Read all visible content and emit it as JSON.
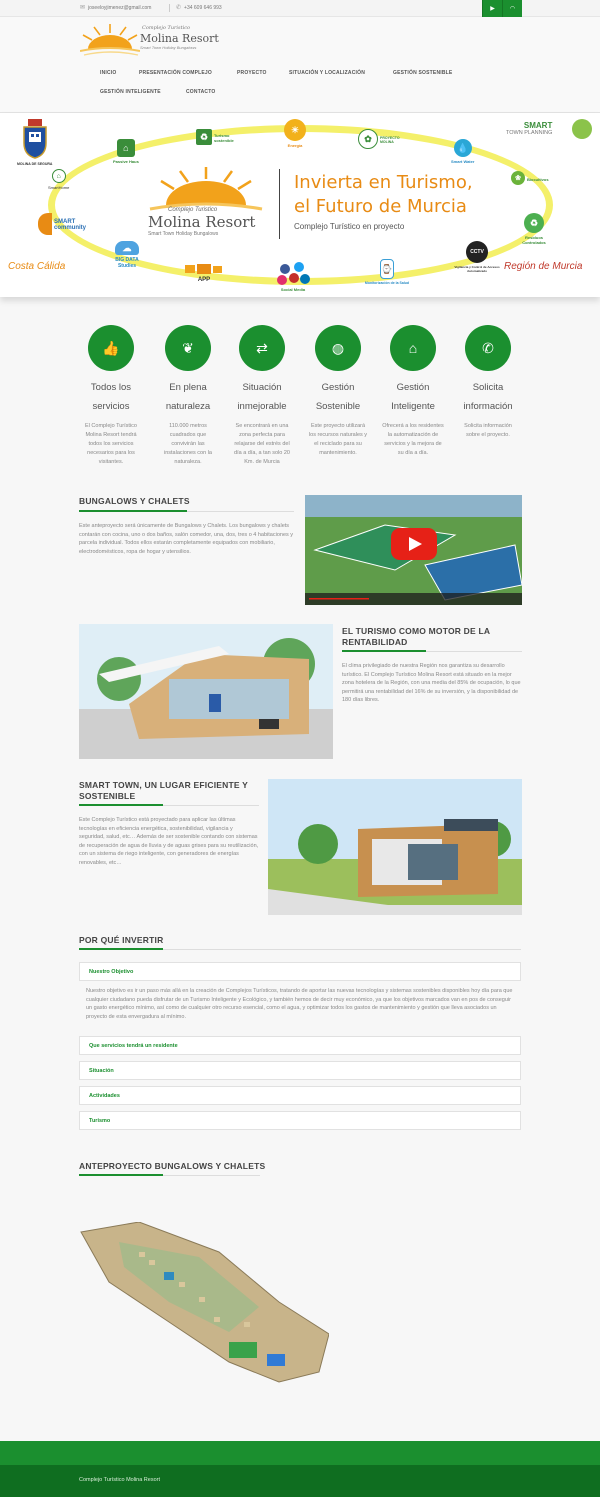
{
  "topbar": {
    "email": "joseeloyjimenez@gmail.com",
    "phone": "+34 609 646 993",
    "social": [
      {
        "icon": "youtube-icon",
        "glyph": "▶"
      },
      {
        "icon": "rss-icon",
        "glyph": "◠"
      }
    ]
  },
  "logo": {
    "small": "Complejo Turistico",
    "name": "Molina Resort",
    "tag": "Smart Town Holiday Bungalows"
  },
  "nav": {
    "inicio": "INICIO",
    "presentacion": "PRESENTACIÓN COMPLEJO",
    "proyecto": "PROYECTO",
    "situacion": "SITUACIÓN Y LOCALIZACIÓN",
    "sostenible": "GESTIÓN SOSTENIBLE",
    "inteligente": "GESTIÓN INTELIGENTE",
    "contacto": "CONTACTO"
  },
  "banner": {
    "title_line1": "Invierta en Turismo,",
    "title_line2": "el Futuro de Murcia",
    "subtitle": "Complejo Turístico en proyecto",
    "logo_small": "Complejo Turistico",
    "logo_name": "Molina Resort",
    "logo_tag": "Smart Town Holiday Bungalows",
    "costa": "Costa Cálida",
    "region": "Región de Murcia",
    "smart_town": "SMART",
    "smart_town2": "TOWN PLANNING",
    "molina_label": "MOLINA DE SEGURA",
    "icons": {
      "passive": "Passive Haus",
      "turismo": "Turismo sostenible",
      "energia": "Energía",
      "proyecto": "PROYECTO MOLINA",
      "water": "Smart Water",
      "biocultivos": "Biocultivos",
      "residuos": "Residuos Controlados",
      "cctv": "CCTV",
      "vigilancia": "Vigilancia y Control de Accesos Automatizado",
      "monitorizacion": "Monitorización de la Salud",
      "social": "Social Media",
      "app": "APP",
      "bigdata": "BIG DATA Studies",
      "smartcommunity": "SMART community",
      "smarthome": "SmartHome"
    }
  },
  "features": [
    {
      "icon": "thumbs-up-icon",
      "glyph": "👍",
      "title1": "Todos los",
      "title2": "servicios",
      "text": "El Complejo Turístico Molina Resort tendrá todos los servicios necesarios para los visitantes."
    },
    {
      "icon": "leaf-icon",
      "glyph": "❦",
      "title1": "En plena",
      "title2": "naturaleza",
      "text": "110.000 metros cuadrados que convivirán las instalaciones con la naturaleza."
    },
    {
      "icon": "signpost-icon",
      "glyph": "⇄",
      "title1": "Situación",
      "title2": "inmejorable",
      "text": "Se encontrará en una zona perfecta para relajarse del estrés del día a día, a tan solo 20 Km. de Murcia"
    },
    {
      "icon": "globe-icon",
      "glyph": "◍",
      "title1": "Gestión",
      "title2": "Sostenible",
      "text": "Este proyecto utilizará los recursos naturales y el reciclado para su mantenimiento."
    },
    {
      "icon": "home-icon",
      "glyph": "⌂",
      "title1": "Gestión",
      "title2": "Inteligente",
      "text": "Ofrecerá a los residentes la automatización de servicios y la mejora de su día a día."
    },
    {
      "icon": "phone-icon",
      "glyph": "✆",
      "title1": "Solicita",
      "title2": "información",
      "text": "Solicita información sobre el proyecto."
    }
  ],
  "bungalows": {
    "title": "BUNGALOWS Y CHALETS",
    "text": "Este anteproyecto será únicamente de Bungalows y Chalets. Los bungalows y chalets contarán con cocina, uno o dos baños, salón comedor, una, dos, tres o 4 habitaciones y parcela individual. Todos ellos estarán completamente equipados con mobiliario, electrodomésticos, ropa de hogar y utensilios."
  },
  "turismo": {
    "title": "EL TURISMO COMO MOTOR DE LA RENTABILIDAD",
    "text": "El clima privilegiado de nuestra Región nos garantiza su desarrollo turístico. El Complejo Turístico Molina Resort está situado en la mejor zona hotelera de la Región, con una media del 85% de ocupación, lo que permitirá una rentabilidad del 16% de su inversión, y la disponibilidad de 180 días libres."
  },
  "smarttown": {
    "title": "SMART TOWN, UN LUGAR EFICIENTE Y SOSTENIBLE",
    "text": "Este Complejo Turístico está proyectado para aplicar las últimas tecnologías en eficiencia energética, sostenibilidad, vigilancia y seguridad, salud, etc… Además de ser sostenible contando con sistemas de recuperación de agua de lluvia y de aguas grises para su reutilización, con un sistema de riego inteligente, con generadores de energías renovables, etc…"
  },
  "invertir": {
    "title": "POR QUÉ INVERTIR",
    "objetivo_label": "Nuestro Objetivo",
    "objetivo_text": "Nuestro objetivo es ir un paso más allá en la creación de Complejos Turísticos, tratando de aportar las nuevas tecnologías y sistemas sostenibles disponibles hoy día para que cualquier ciudadano pueda disfrutar de un Turismo Inteligente y Ecológico, y también hemos de decir muy económico, ya que los objetivos marcados van en pos de conseguir un gasto energético mínimo, así como de cualquier otro recurso esencial, como el agua, y optimizar todos los gastos de mantenimiento y gestión que lleva asociados un proyecto de esta envergadura al mínimo.",
    "servicios_label": "Que servicios tendrá un residente",
    "situacion_label": "Situación",
    "actividades_label": "Actividades",
    "turismo_label": "Turismo"
  },
  "anteproyecto": {
    "title": "ANTEPROYECTO BUNGALOWS Y CHALETS"
  },
  "footer": {
    "text": "Complejo Turístico Molina Resort"
  },
  "colors": {
    "accent": "#1b8f2f",
    "orange": "#e88b14"
  }
}
